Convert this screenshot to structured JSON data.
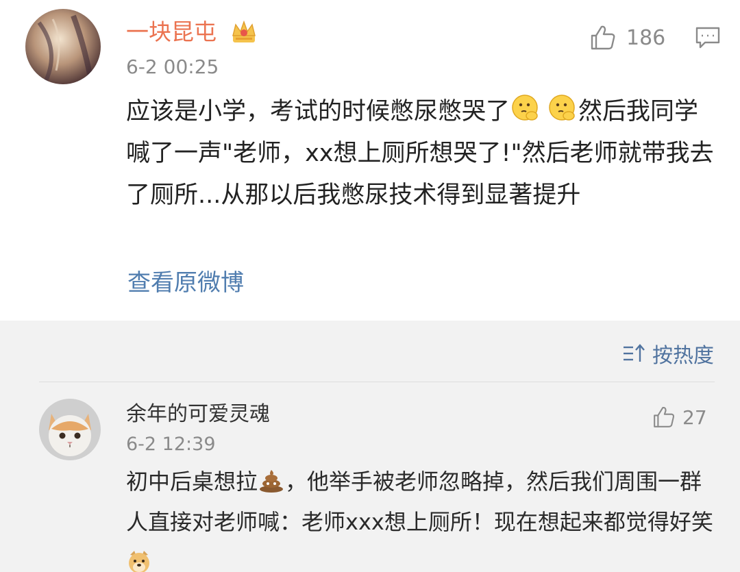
{
  "post": {
    "username": "一块昆屯",
    "badge_icon": "crown-icon",
    "time": "6-2 00:25",
    "likes": "186",
    "text_line1": "应该是小学，考试的时候憋尿憋哭了",
    "text_line1_end": "然后我",
    "text_rest": "同学喊了一声\"老师，xx想上厕所想哭了!\"然后老师就带我去了厕所...从那以后我憋尿技术得到显著提升",
    "view_original": "查看原微博"
  },
  "sort": {
    "label": "按热度",
    "icon": "sort-icon"
  },
  "reply": {
    "username": "余年的可爱灵魂",
    "time": "6-2 12:39",
    "likes": "27",
    "text_start": "初中后桌想拉",
    "text_mid": "，他举手被老师忽略掉，然后我们周围一群人直接对老师喊：老师xxx想上厕所！现在想起来都觉得好笑"
  },
  "colors": {
    "username": "#eb7350",
    "link": "#507daf",
    "meta": "#8a8a8a",
    "section_bg": "#f2f2f2"
  }
}
